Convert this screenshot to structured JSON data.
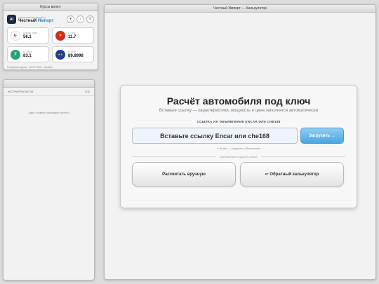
{
  "rates_window": {
    "title": "Курсы валют",
    "brand": {
      "logo": "AI",
      "subtitle": "КАЛЬКУЛЯТОР РАСЧЁТА",
      "name_main": "Честный",
      "name_accent": "Импорт"
    },
    "buttons": [
      "▾",
      "↓",
      "↺"
    ],
    "rates": [
      {
        "label": "1000 ₩ · KRW",
        "value": "56.1",
        "icon": "krw-flag-icon",
        "glyph": "☯"
      },
      {
        "label": "¥ · CNY",
        "value": "11.7",
        "icon": "cny-flag-icon",
        "glyph": "★"
      },
      {
        "label": "₮ · USDT",
        "value": "83.1",
        "icon": "usdt-icon",
        "glyph": "₮"
      },
      {
        "label": "€ · EUR",
        "value": "89.8998",
        "icon": "eur-flag-icon",
        "glyph": "★★"
      }
    ],
    "footer": "Резервные курсы · 18.07.2026 · Vesolixo"
  },
  "history_window": {
    "header_title": "ИСТОРИЯ РАСЧЁТОВ",
    "header_count": "0/10",
    "empty_text": "Здесь появятся последние расчёты"
  },
  "main_window": {
    "title": "Честный Импорт — Калькулятор",
    "card": {
      "title": "Расчёт автомобиля под ключ",
      "subtitle": "Вставьте ссылку — характеристики, мощность и цена заполнятся автоматически",
      "link_label": "ССЫЛКА НА ОБЪЯВЛЕНИЕ ENCAR ИЛИ CHE168",
      "input_placeholder": "Вставьте ссылку Encar или che168",
      "load_button": "Загрузить →",
      "enter_hint": "↵ Enter — загрузить объявление",
      "divider": "или выберите другой способ",
      "manual_button": "Рассчитать вручную",
      "reverse_button": "↩ Обратный калькулятор"
    }
  }
}
